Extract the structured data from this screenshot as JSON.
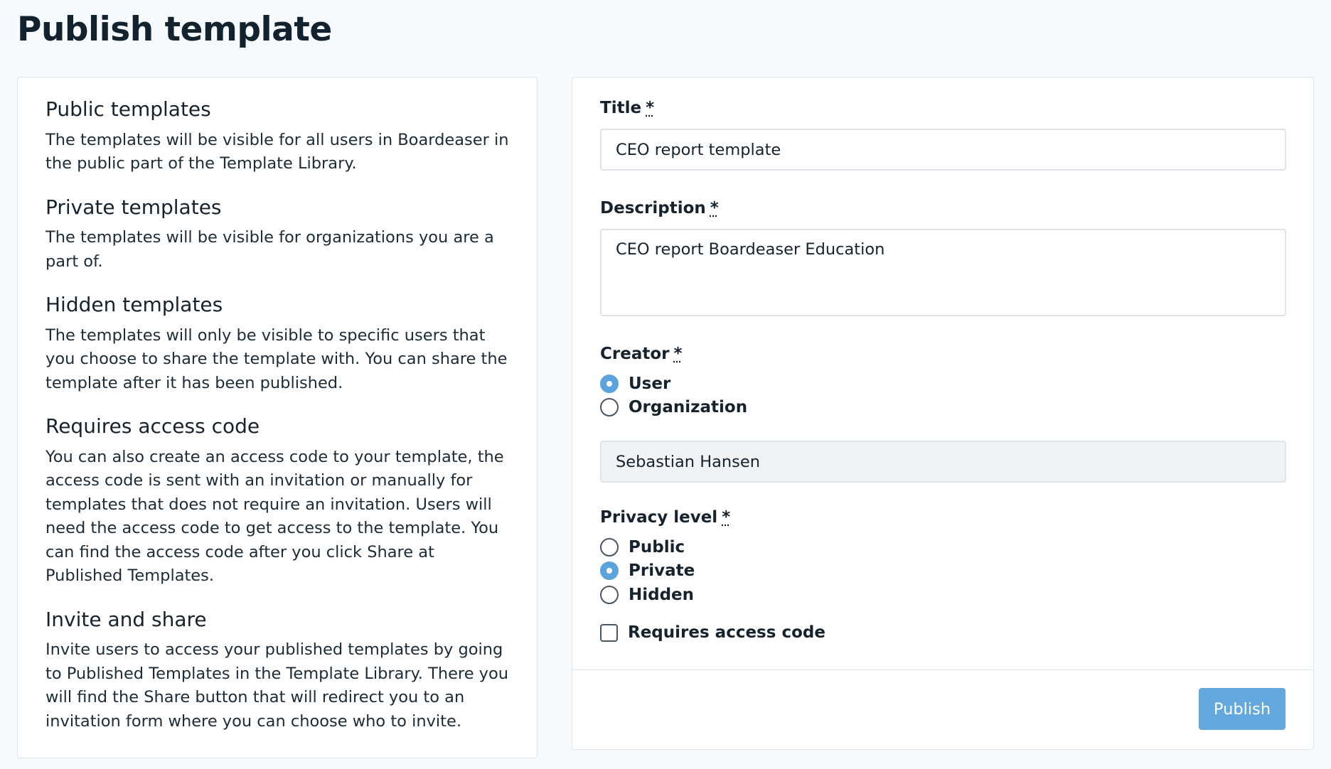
{
  "page": {
    "title": "Publish template"
  },
  "info": {
    "sections": [
      {
        "heading": "Public templates",
        "body": "The templates will be visible for all users in Boardeaser in the public part of the Template Library."
      },
      {
        "heading": "Private templates",
        "body": "The templates will be visible for organizations you are a part of."
      },
      {
        "heading": "Hidden templates",
        "body": "The templates will only be visible to specific users that you choose to share the template with. You can share the template after it has been published."
      },
      {
        "heading": "Requires access code",
        "body": "You can also create an access code to your template, the access code is sent with an invitation or manually for templates that does not require an invitation. Users will need the access code to get access to the template. You can find the access code after you click Share at Published Templates."
      },
      {
        "heading": "Invite and share",
        "body": "Invite users to access your published templates by going to Published Templates in the Template Library. There you will find the Share button that will redirect you to an invitation form where you can choose who to invite."
      }
    ]
  },
  "form": {
    "title": {
      "label": "Title",
      "required_mark": "*",
      "value": "CEO report template"
    },
    "description": {
      "label": "Description",
      "required_mark": "*",
      "value": "CEO report Boardeaser Education"
    },
    "creator": {
      "label": "Creator",
      "required_mark": "*",
      "options": [
        {
          "label": "User",
          "checked": true
        },
        {
          "label": "Organization",
          "checked": false
        }
      ],
      "selected_name": "Sebastian Hansen"
    },
    "privacy": {
      "label": "Privacy level",
      "required_mark": "*",
      "options": [
        {
          "label": "Public",
          "checked": false
        },
        {
          "label": "Private",
          "checked": true
        },
        {
          "label": "Hidden",
          "checked": false
        }
      ]
    },
    "access_code": {
      "label": "Requires access code",
      "checked": false
    },
    "publish_label": "Publish"
  },
  "colors": {
    "accent": "#5ba3dc",
    "button": "#64a8e0",
    "border": "#dde3e8"
  }
}
